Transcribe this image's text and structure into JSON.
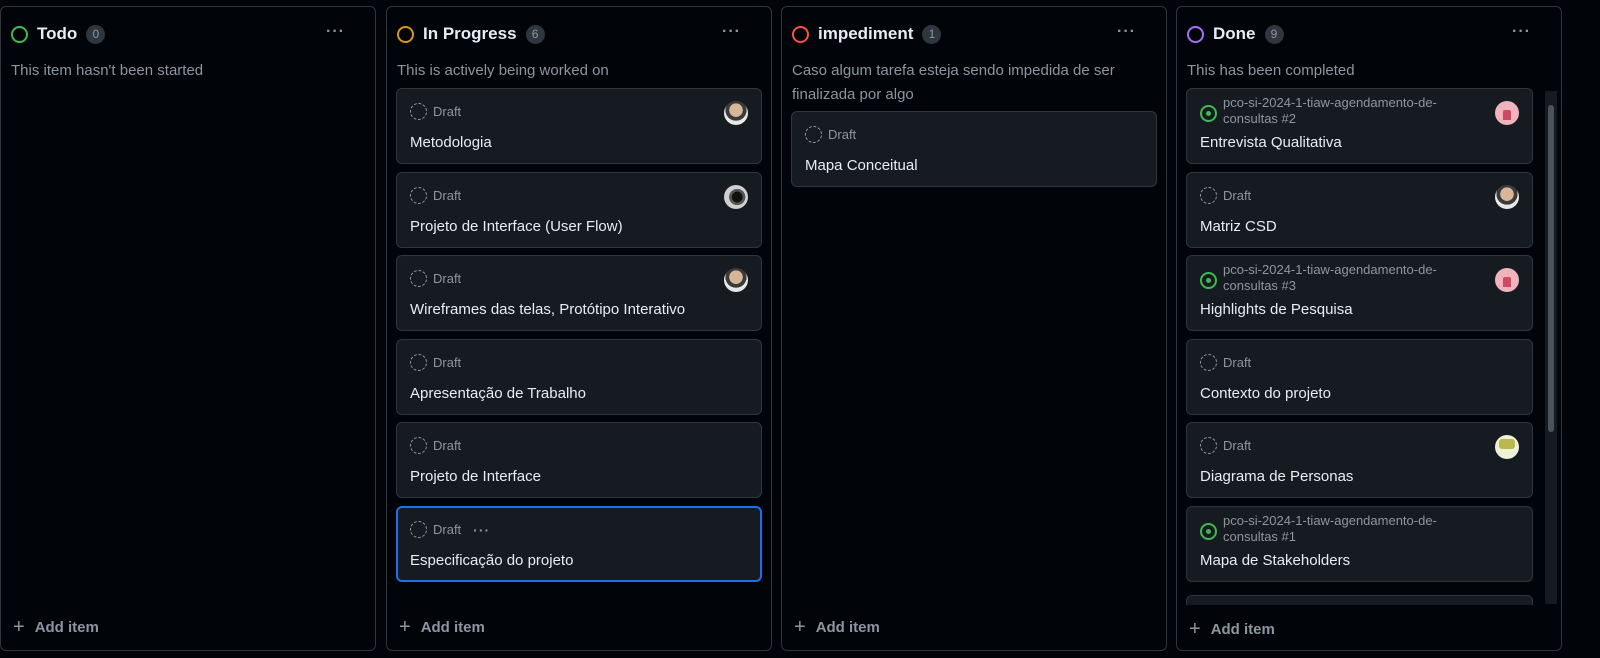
{
  "columns": [
    {
      "title": "Todo",
      "count": "0",
      "status_color": "#3fb950",
      "description": "This item hasn't been started",
      "add_label": "Add item",
      "cards": []
    },
    {
      "title": "In Progress",
      "count": "6",
      "status_color": "#d29922",
      "description": "This is actively being worked on",
      "add_label": "Add item",
      "cards": [
        {
          "meta": "Draft",
          "title": "Metodologia",
          "avatar": "person-with-camera"
        },
        {
          "meta": "Draft",
          "title": "Projeto de Interface (User Flow)",
          "avatar": "camera"
        },
        {
          "meta": "Draft",
          "title": "Wireframes das telas, Protótipo Interativo",
          "avatar": "person"
        },
        {
          "meta": "Draft",
          "title": "Apresentação de Trabalho"
        },
        {
          "meta": "Draft",
          "title": "Projeto de Interface"
        },
        {
          "meta": "Draft",
          "title": "Especificação do projeto",
          "selected": true,
          "menu": "···"
        }
      ]
    },
    {
      "title": "impediment",
      "count": "1",
      "status_color": "#f85149",
      "description": "Caso algum tarefa esteja sendo impedida de ser finalizada por algo",
      "add_label": "Add item",
      "cards": [
        {
          "meta": "Draft",
          "title": "Mapa Conceitual"
        }
      ]
    },
    {
      "title": "Done",
      "count": "9",
      "status_color": "#a371f7",
      "description": "This has been completed",
      "add_label": "Add item",
      "cards": [
        {
          "meta": "pco-si-2024-1-tiaw-agendamento-de-consultas #2",
          "title": "Entrevista Qualitativa",
          "avatar": "identicon-red"
        },
        {
          "meta": "Draft",
          "title": "Matriz CSD",
          "avatar": "person"
        },
        {
          "meta": "pco-si-2024-1-tiaw-agendamento-de-consultas #3",
          "title": "Highlights de Pesquisa",
          "avatar": "identicon-red"
        },
        {
          "meta": "Draft",
          "title": "Contexto do projeto"
        },
        {
          "meta": "Draft",
          "title": "Diagrama de Personas",
          "avatar": "identicon-olive"
        },
        {
          "meta": "pco-si-2024-1-tiaw-agendamento-de-consultas #1",
          "title": "Mapa de Stakeholders"
        }
      ]
    }
  ],
  "icons": {
    "column_menu": "···",
    "add": "+"
  }
}
